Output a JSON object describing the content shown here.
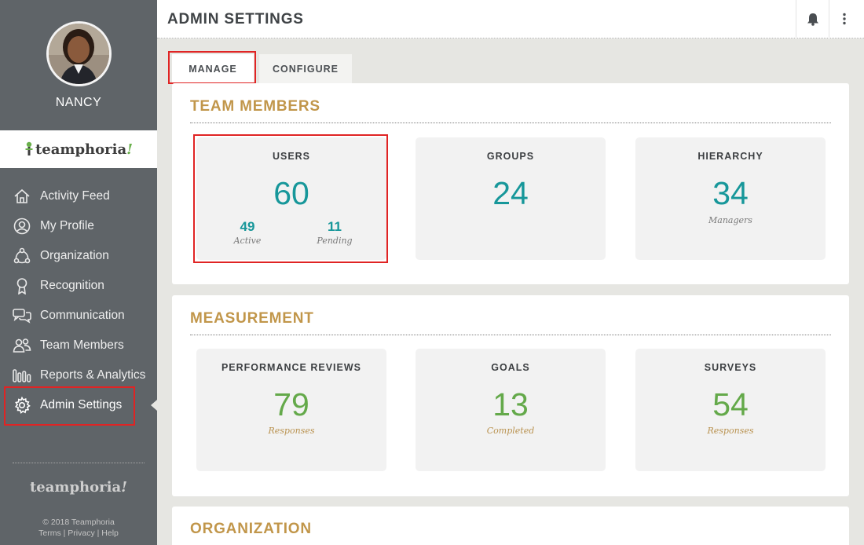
{
  "user": {
    "name": "NANCY"
  },
  "brand": {
    "name": "teamphoria",
    "bang": "!",
    "copyright": "© 2018 Teamphoria"
  },
  "nav": [
    {
      "label": "Activity Feed",
      "icon": "home-icon"
    },
    {
      "label": "My Profile",
      "icon": "profile-icon"
    },
    {
      "label": "Organization",
      "icon": "organization-icon"
    },
    {
      "label": "Recognition",
      "icon": "ribbon-icon"
    },
    {
      "label": "Communication",
      "icon": "chat-icon"
    },
    {
      "label": "Team Members",
      "icon": "team-icon"
    },
    {
      "label": "Reports & Analytics",
      "icon": "bar-chart-icon"
    },
    {
      "label": "Admin Settings",
      "icon": "gear-icon",
      "active": true
    }
  ],
  "footer_links": {
    "terms": "Terms",
    "sep": " | ",
    "privacy": "Privacy",
    "help": "Help"
  },
  "header": {
    "title": "ADMIN SETTINGS",
    "icons": [
      "bell-icon",
      "more-vertical-icon"
    ]
  },
  "tabs": {
    "manage": "MANAGE",
    "configure": "CONFIGURE"
  },
  "team_members": {
    "title": "TEAM MEMBERS",
    "users": {
      "label": "USERS",
      "value": "60",
      "active_value": "49",
      "active_label": "Active",
      "pending_value": "11",
      "pending_label": "Pending"
    },
    "groups": {
      "label": "GROUPS",
      "value": "24"
    },
    "hierarchy": {
      "label": "HIERARCHY",
      "value": "34",
      "sub": "Managers"
    }
  },
  "measurement": {
    "title": "MEASUREMENT",
    "reviews": {
      "label": "PERFORMANCE REVIEWS",
      "value": "79",
      "sub": "Responses"
    },
    "goals": {
      "label": "GOALS",
      "value": "13",
      "sub": "Completed"
    },
    "surveys": {
      "label": "SURVEYS",
      "value": "54",
      "sub": "Responses"
    }
  },
  "organization": {
    "title": "ORGANIZATION"
  },
  "colors": {
    "sidebar": "#5f6468",
    "accent_teal": "#17979a",
    "accent_green": "#64a94a",
    "accent_gold": "#c1964a",
    "highlight": "#e02424"
  }
}
